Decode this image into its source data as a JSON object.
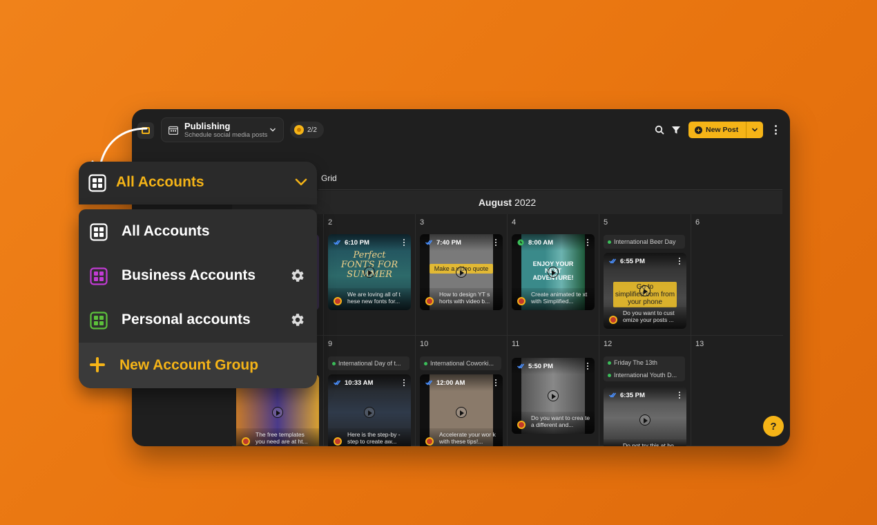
{
  "header": {
    "module_title": "Publishing",
    "module_subtitle": "Schedule social media posts",
    "credits": "2/2",
    "new_post_label": "New Post"
  },
  "view": {
    "tab_label": "Grid",
    "month_bold": "August",
    "year": "2022"
  },
  "days": [
    {
      "num": "2"
    },
    {
      "num": "3"
    },
    {
      "num": "4"
    },
    {
      "num": "5"
    },
    {
      "num": "6"
    },
    {
      "num": "9"
    },
    {
      "num": "10"
    },
    {
      "num": "11"
    },
    {
      "num": "12"
    },
    {
      "num": "13"
    }
  ],
  "events": [
    "International Beer Day",
    "International Day of t...",
    "International Coworki...",
    "Friday The 13th",
    "International Youth D..."
  ],
  "posts": [
    {
      "time": "6:10 PM",
      "overlay": "Perfect FONTS FOR SUMMER",
      "caption": "We are loving all of t hese new fonts for..."
    },
    {
      "time": "7:40 PM",
      "overlay": "Make a video quote",
      "caption": "How to design YT s horts with video b..."
    },
    {
      "time": "8:00 AM",
      "overlay": "ENJOY YOUR NEXT ADVENTURE!",
      "caption": "Create animated te xt with Simplified..."
    },
    {
      "time": "6:55 PM",
      "overlay": "Go to simplified.com from your phone",
      "caption": "Do you want to cust omize your posts ..."
    },
    {
      "time": "",
      "overlay": "",
      "caption": "The free templates you need are at ht..."
    },
    {
      "time": "10:33 AM",
      "overlay": "",
      "caption": "Here is the step-by -step to create aw..."
    },
    {
      "time": "12:00 AM",
      "overlay": "",
      "caption": "Accelerate your wor k with these tips!..."
    },
    {
      "time": "5:50 PM",
      "overlay": "",
      "caption": "Do you want to crea te a different and..."
    },
    {
      "time": "6:35 PM",
      "overlay": "",
      "caption": "Do not try this at ho..."
    }
  ],
  "dropdown": {
    "selected": "All Accounts",
    "items": [
      {
        "label": "All Accounts",
        "color": "#ffffff"
      },
      {
        "label": "Business Accounts",
        "color": "#c23bd4"
      },
      {
        "label": "Personal accounts",
        "color": "#5cc03b"
      }
    ],
    "new_group_label": "New Account Group"
  },
  "colors": {
    "accent": "#f5b417",
    "background": "#ef7d17",
    "panel": "#1f1f1f"
  },
  "help_label": "?"
}
